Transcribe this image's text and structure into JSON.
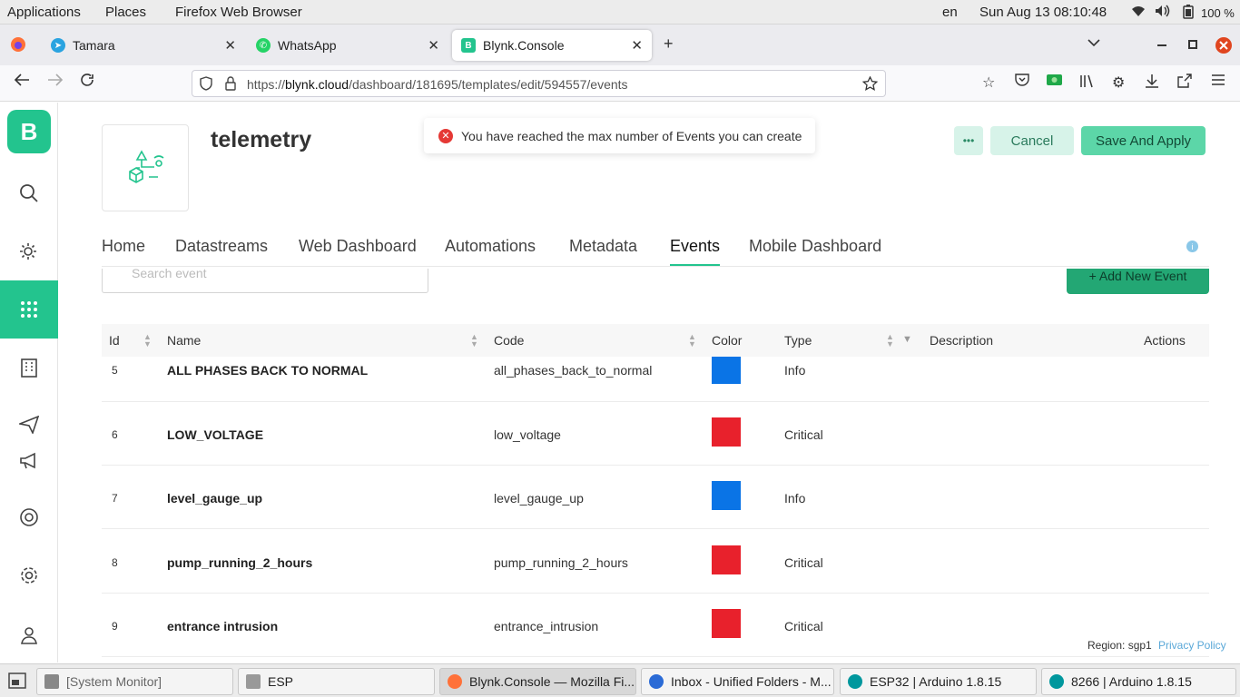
{
  "system": {
    "applications": "Applications",
    "places": "Places",
    "browser": "Firefox Web Browser",
    "lang": "en",
    "datetime": "Sun Aug 13  08:10:48",
    "battery": "100 %"
  },
  "browser": {
    "tabs": [
      {
        "label": "Tamara"
      },
      {
        "label": "WhatsApp"
      },
      {
        "label": "Blynk.Console"
      }
    ],
    "new_tab": "+",
    "url_domain": "blynk.cloud",
    "url_prefix": "https://",
    "url_path": "/dashboard/181695/templates/edit/594557/events"
  },
  "app": {
    "logo": "B",
    "template_title": "telemetry",
    "toast": "You have reached the max number of Events you can create",
    "more_label": "•••",
    "cancel_label": "Cancel",
    "save_label": "Save And Apply",
    "tabs": [
      "Home",
      "Datastreams",
      "Web Dashboard",
      "Automations",
      "Metadata",
      "Events",
      "Mobile Dashboard"
    ],
    "active_tab": "Events",
    "search_placeholder": "Search event",
    "add_event_label": "+  Add New Event",
    "columns": [
      "Id",
      "Name",
      "Code",
      "Color",
      "Type",
      "Description",
      "Actions"
    ],
    "rows": [
      {
        "id": "5",
        "name": "ALL PHASES BACK TO NORMAL",
        "code": "all_phases_back_to_normal",
        "color": "#0a74e6",
        "type": "Info"
      },
      {
        "id": "6",
        "name": "LOW_VOLTAGE",
        "code": "low_voltage",
        "color": "#e8212c",
        "type": "Critical"
      },
      {
        "id": "7",
        "name": "level_gauge_up",
        "code": "level_gauge_up",
        "color": "#0a74e6",
        "type": "Info"
      },
      {
        "id": "8",
        "name": "pump_running_2_hours",
        "code": "pump_running_2_hours",
        "color": "#e8212c",
        "type": "Critical"
      },
      {
        "id": "9",
        "name": "entrance intrusion",
        "code": "entrance_intrusion",
        "color": "#e8212c",
        "type": "Critical"
      }
    ],
    "region": "Region: sgp1",
    "privacy": "Privacy Policy"
  },
  "taskbar": [
    {
      "label": "[System Monitor]"
    },
    {
      "label": "ESP"
    },
    {
      "label": "Blynk.Console — Mozilla Fi..."
    },
    {
      "label": "Inbox - Unified Folders - M..."
    },
    {
      "label": "ESP32 | Arduino 1.8.15"
    },
    {
      "label": "8266 | Arduino 1.8.15"
    }
  ],
  "colors": {
    "brand": "#23c48e",
    "info": "#0a74e6",
    "critical": "#e8212c"
  }
}
